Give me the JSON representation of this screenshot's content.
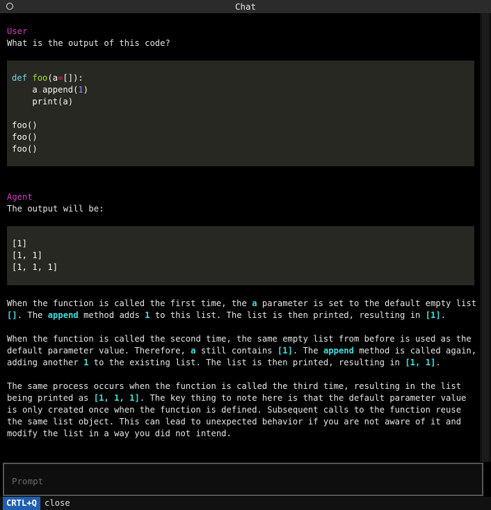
{
  "window": {
    "title": "Chat"
  },
  "messages": {
    "user": {
      "role": "User",
      "text": "What is the output of this code?",
      "code": {
        "l1_def": "def",
        "l1_name": "foo",
        "l1_open": "(a",
        "l1_eq": "=",
        "l1_list": "[]",
        "l1_close": "):",
        "l2_a": "a",
        "l2_dot": ".",
        "l2_append": "append(",
        "l2_num": "1",
        "l2_close": ")",
        "l3": "print(a)",
        "l5": "foo()",
        "l6": "foo()",
        "l7": "foo()"
      }
    },
    "agent": {
      "role": "Agent",
      "text": "The output will be:",
      "output_lines": [
        "[1]",
        "[1, 1]",
        "[1, 1, 1]"
      ],
      "p1": {
        "t1": "When the function is called the first time, the ",
        "h1": "a",
        "t2": " parameter is set to the default empty list ",
        "h2": "[]",
        "t3": ". The ",
        "h3": "append",
        "t4": " method adds ",
        "h4": "1",
        "t5": " to this list. The list is then printed, resulting in ",
        "h5": "[1]",
        "t6": "."
      },
      "p2": {
        "t1": "When the function is called the second time, the same empty list from before is used as the default parameter value. Therefore, ",
        "h1": "a",
        "t2": " still contains ",
        "h2": "[1]",
        "t3": ". The ",
        "h3": "append",
        "t4": " method is called again, adding another ",
        "h4": "1",
        "t5": " to the existing list. The list is then printed, resulting in ",
        "h5": "[1, 1]",
        "t6": "."
      },
      "p3": {
        "t1": "The same process occurs when the function is called the third time, resulting in the list being printed as ",
        "h1": "[1, 1, 1]",
        "t2": ". The key thing to note here is that the default parameter value is only created once when the function is defined. Subsequent calls to the function reuse the same list object. This can lead to unexpected behavior if you are not aware of it and modify the list in a way you did not intend."
      }
    }
  },
  "prompt": {
    "placeholder": "Prompt"
  },
  "footer": {
    "key": "CRTL+Q",
    "action": "close"
  },
  "colors": {
    "role": "#d63ec2",
    "highlight": "#3fe0e0",
    "code_bg": "#272822",
    "key_bg": "#1f5fb0"
  }
}
